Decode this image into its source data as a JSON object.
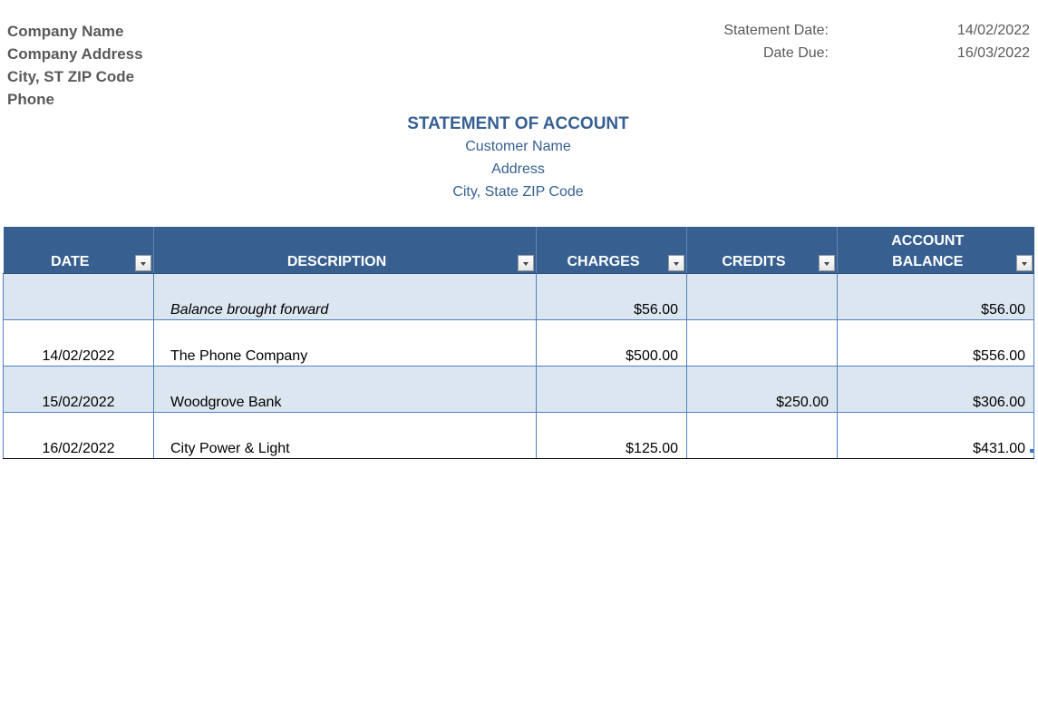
{
  "company": {
    "name": "Company Name",
    "address": "Company Address",
    "city_line": "City, ST  ZIP Code",
    "phone": "Phone"
  },
  "statement_meta": {
    "statement_date_label": "Statement Date:",
    "statement_date": "14/02/2022",
    "date_due_label": "Date Due:",
    "date_due": "16/03/2022"
  },
  "header": {
    "title": "STATEMENT OF ACCOUNT",
    "customer_name": "Customer Name",
    "customer_address": "Address",
    "customer_city_line": "City, State  ZIP Code"
  },
  "table": {
    "columns": [
      {
        "label": "DATE",
        "filter_icon": "dropdown-arrow-icon"
      },
      {
        "label": "DESCRIPTION",
        "filter_icon": "dropdown-arrow-icon"
      },
      {
        "label": "CHARGES",
        "filter_icon": "dropdown-arrow-icon"
      },
      {
        "label": "CREDITS",
        "filter_icon": "dropdown-arrow-icon"
      },
      {
        "label_line1": "ACCOUNT",
        "label_line2": "BALANCE",
        "filter_icon": "dropdown-arrow-icon"
      }
    ],
    "rows": [
      {
        "date": "",
        "description": "Balance brought forward",
        "charges": "$56.00",
        "credits": "",
        "balance": "$56.00"
      },
      {
        "date": "14/02/2022",
        "description": "The Phone Company",
        "charges": "$500.00",
        "credits": "",
        "balance": "$556.00"
      },
      {
        "date": "15/02/2022",
        "description": "Woodgrove Bank",
        "charges": "",
        "credits": "$250.00",
        "balance": "$306.00"
      },
      {
        "date": "16/02/2022",
        "description": "City Power & Light",
        "charges": "$125.00",
        "credits": "",
        "balance": "$431.00"
      }
    ]
  },
  "colors": {
    "header_bg": "#376091",
    "band_bg": "#dce6f1",
    "title_text": "#366092",
    "company_text": "#595959",
    "grid_line": "#4f81bd"
  }
}
